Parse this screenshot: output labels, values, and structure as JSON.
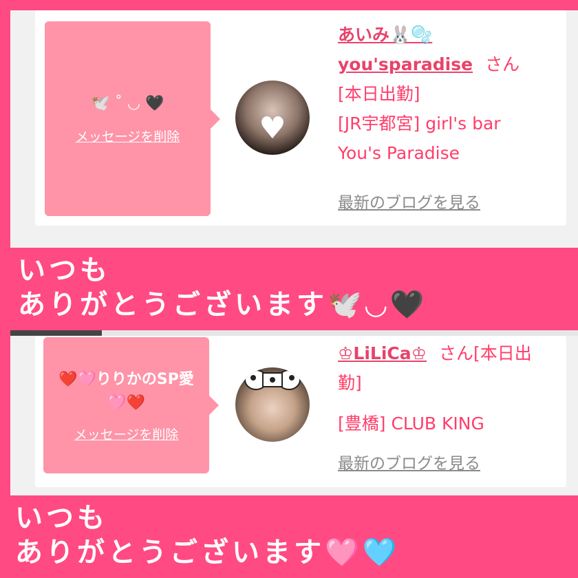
{
  "entries": [
    {
      "message": "🕊️ ˚ ◡ 🖤",
      "delete_label": "メッセージを削除",
      "name_line1": "あいみ🐰🫧",
      "name_line2": "you'sparadise",
      "san": "さん",
      "status": "[本日出勤]",
      "shop_line1": "[JR宇都宮] girl's bar",
      "shop_line2": "You's Paradise",
      "blog_label": "最新のブログを見る"
    },
    {
      "message": "❤️🩷りりかのSP愛🩷❤️",
      "delete_label": "メッセージを削除",
      "name": "♔LiLiCa♔",
      "san_status": "さん[本日出勤]",
      "shop": "[豊橋] CLUB KING",
      "blog_label": "最新のブログを見る"
    }
  ],
  "captions": [
    {
      "line1": "いつも",
      "line2": "ありがとうございます🕊️◡🖤"
    },
    {
      "line1": "いつも",
      "line2": "ありがとうございます🩷🩵"
    }
  ],
  "colors": {
    "background": "#ff4a84",
    "bubble": "#ff94a8",
    "text_accent": "#ff3d6a",
    "link_gray": "#8a8a8a"
  }
}
